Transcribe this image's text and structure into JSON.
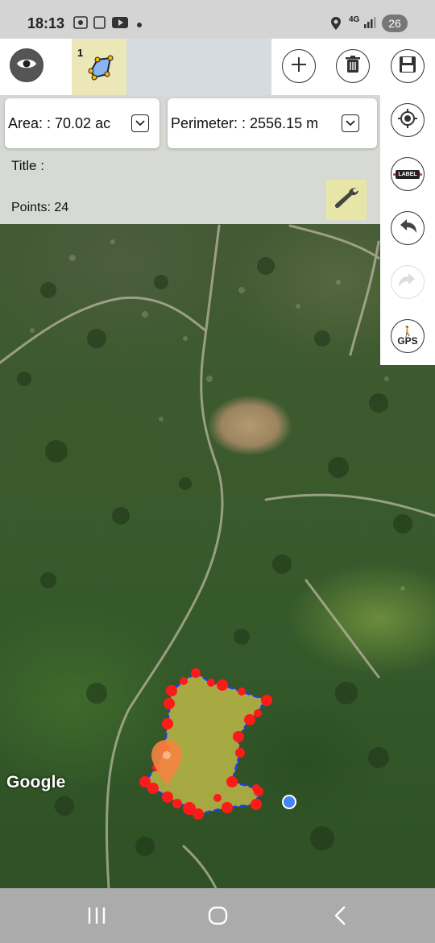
{
  "status_bar": {
    "time": "18:13",
    "network": "4G",
    "battery": "26",
    "icons": [
      "screen-record-icon",
      "copy-icon",
      "youtube-icon",
      "dot-icon",
      "location-icon",
      "network-icon",
      "signal-icon",
      "battery-icon"
    ]
  },
  "toolbar": {
    "shape_tab_number": "1",
    "icons": [
      "eye-icon",
      "polygon-icon",
      "plus-icon",
      "trash-icon",
      "save-icon"
    ]
  },
  "info": {
    "area_label": "Area: : 70.02 ac",
    "perimeter_label": "Perimeter: : 2556.15 m",
    "title_label": "Title :",
    "points_label": "Points: 24"
  },
  "side_tools": {
    "label_button": "LABEL",
    "gps_button": "GPS",
    "icons": [
      "locate-icon",
      "label-icon",
      "undo-icon",
      "redo-icon",
      "gps-icon"
    ]
  },
  "map": {
    "attribution": "Google",
    "polygon_fill": "#c8c24a",
    "vertex_color": "#ff1a1a",
    "edge_color": "#1a3cff",
    "location_dot_color": "#4285f4"
  },
  "nav_bar": {
    "icons": [
      "recents-icon",
      "home-icon",
      "back-icon"
    ]
  }
}
